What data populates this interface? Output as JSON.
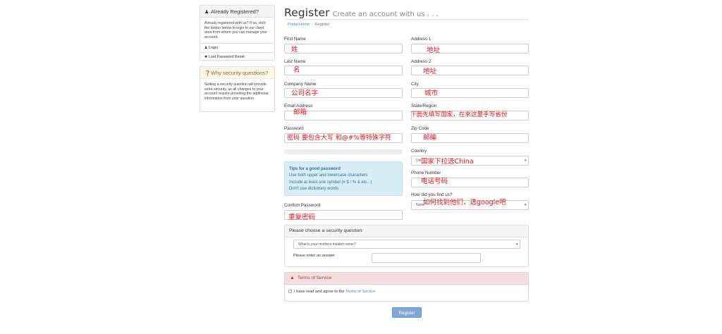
{
  "sidebar": {
    "registered": {
      "title": "Already Registered?",
      "body": "Already registered with us? If so, click the button below to login to our client area from where you can manage your account.",
      "links": [
        {
          "label": "Login",
          "icon": "user-icon"
        },
        {
          "label": "Lost Password Reset",
          "icon": "asterisk-icon"
        }
      ]
    },
    "security": {
      "title": "Why security questions?",
      "body": "Setting a security question will provide extra security, as all changes to your account require providing the additional information from your question."
    }
  },
  "header": {
    "title": "Register",
    "subtitle": "Create an account with us . . .",
    "breadcrumb": [
      "Portal Home",
      "Register"
    ]
  },
  "form": {
    "first_name": {
      "label": "First Name",
      "annotation": "姓"
    },
    "last_name": {
      "label": "Last Name",
      "annotation": "名"
    },
    "company": {
      "label": "Company Name",
      "annotation": "公司名字"
    },
    "email": {
      "label": "Email Address",
      "annotation": "邮箱"
    },
    "password": {
      "label": "Password",
      "annotation": "密码 要包含大写 和@#%等特殊字符"
    },
    "tips": {
      "title": "Tips for a good password",
      "lines": [
        "Use both upper and lowercase characters",
        "Include at least one symbol (# $ ! % & etc...)",
        "Don't use dictionary words"
      ]
    },
    "confirm_password": {
      "label": "Confirm Password",
      "annotation": "重复密码"
    },
    "address1": {
      "label": "Address 1",
      "annotation": "地址"
    },
    "address2": {
      "label": "Address 2",
      "annotation": "地址"
    },
    "city": {
      "label": "City",
      "annotation": "城市"
    },
    "state": {
      "label": "State/Region",
      "annotation": "下面先填写国家，在来这里手写省份"
    },
    "zip": {
      "label": "Zip Code",
      "annotation": "邮编"
    },
    "country": {
      "label": "Country",
      "value": "Uni",
      "annotation": "国家下拉选China"
    },
    "phone": {
      "label": "Phone Number",
      "annotation": "电话号码"
    },
    "find_us": {
      "label": "How did you find us?",
      "value": "None",
      "annotation": "如何找到他们，选google吧"
    }
  },
  "security_question": {
    "title": "Please choose a security question:",
    "selected": "What is your mothers maiden name?",
    "answer_label": "Please enter an answer"
  },
  "tos": {
    "title": "Terms of Service",
    "agree_text": "I have read and agree to the ",
    "link_text": "Terms of Service"
  },
  "submit_label": "Register",
  "colors": {
    "annotation": "#e8151d",
    "link": "#428bca",
    "button": "#7fa9d4",
    "danger_bg": "#f2dede",
    "info_bg": "#d9edf7"
  }
}
